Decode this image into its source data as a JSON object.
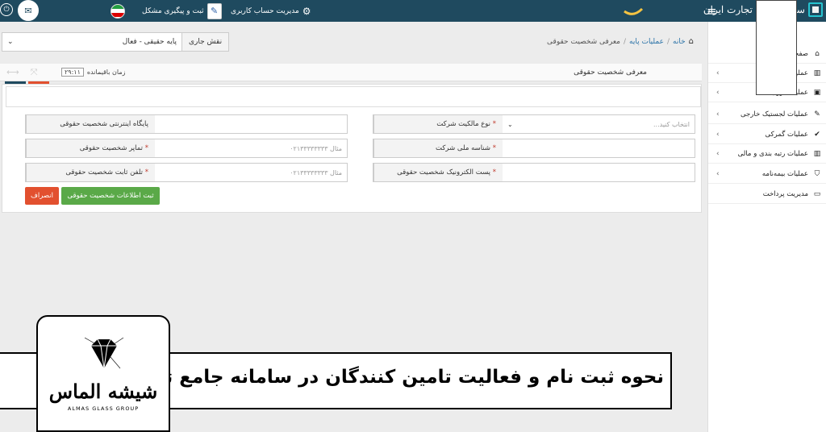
{
  "topbar": {
    "brand": "سامانه جامع تجارت ایران",
    "user_mgmt": "مدیریت حساب کاربری",
    "support": "ثبت و پیگیری مشکل"
  },
  "breadcrumb": {
    "home": "خانه",
    "sep": "/",
    "level1": "عملیات پایه",
    "current": "معرفی شخصیت حقوقی"
  },
  "role": {
    "label": "نقش جاری",
    "value": "پایه حقیقی - فعال"
  },
  "panel": {
    "title": "معرفی شخصیت حقوقی",
    "timer_label": "زمان باقیمانده",
    "timer_value": "۲۹:۱۱"
  },
  "form": {
    "ownership_type": {
      "label": "نوع مالکیت شرکت",
      "placeholder": "انتخاب کنید..."
    },
    "website": {
      "label": "پایگاه اینترنتی شخصیت حقوقی",
      "value": ""
    },
    "national_id": {
      "label": "شناسه ملی شرکت",
      "value": ""
    },
    "mobile": {
      "label": "تماپر شخصیت حقوقی",
      "placeholder": "مثال ۰۲۱۳۳۳۳۳۳۳۳"
    },
    "email": {
      "label": "پست الکترونیک شخصیت حقوقی",
      "value": ""
    },
    "phone": {
      "label": "تلفن ثابت شخصیت حقوقی",
      "placeholder": "مثال ۰۲۱۳۳۳۳۳۳۳۳"
    },
    "submit_label": "ثبت اطلاعات شخصیت حقوقی",
    "cancel_label": "انصراف",
    "required_mark": "*"
  },
  "sidebar": {
    "items": [
      {
        "label": "صفحه اصلی",
        "icon": "home-icon",
        "has_children": false
      },
      {
        "label": "عملیات پایه",
        "icon": "bar-chart-icon",
        "has_children": true
      },
      {
        "label": "عملیات ارزی",
        "icon": "money-icon",
        "has_children": true
      },
      {
        "label": "عملیات لجستیک خارجی",
        "icon": "edit-icon",
        "has_children": true
      },
      {
        "label": "عملیات گمرکی",
        "icon": "check-icon",
        "has_children": true
      },
      {
        "label": "عملیات رتبه بندی و مالی",
        "icon": "bar-chart-icon",
        "has_children": true
      },
      {
        "label": "عملیات بیمه‌نامه",
        "icon": "shield-icon",
        "has_children": true
      },
      {
        "label": "مدیریت پرداخت",
        "icon": "credit-card-icon",
        "has_children": false
      }
    ]
  },
  "banner": {
    "title": "نحوه ثبت نام و فعالیت تامین کنندگان در سامانه جامع تجارت",
    "logo_name": "شیشه الماس",
    "logo_sub": "ALMAS GLASS GROUP"
  },
  "colors": {
    "topbar": "#1f4a5f",
    "submit": "#5aa948",
    "cancel": "#e2502f",
    "accent": "#2b73a8"
  }
}
